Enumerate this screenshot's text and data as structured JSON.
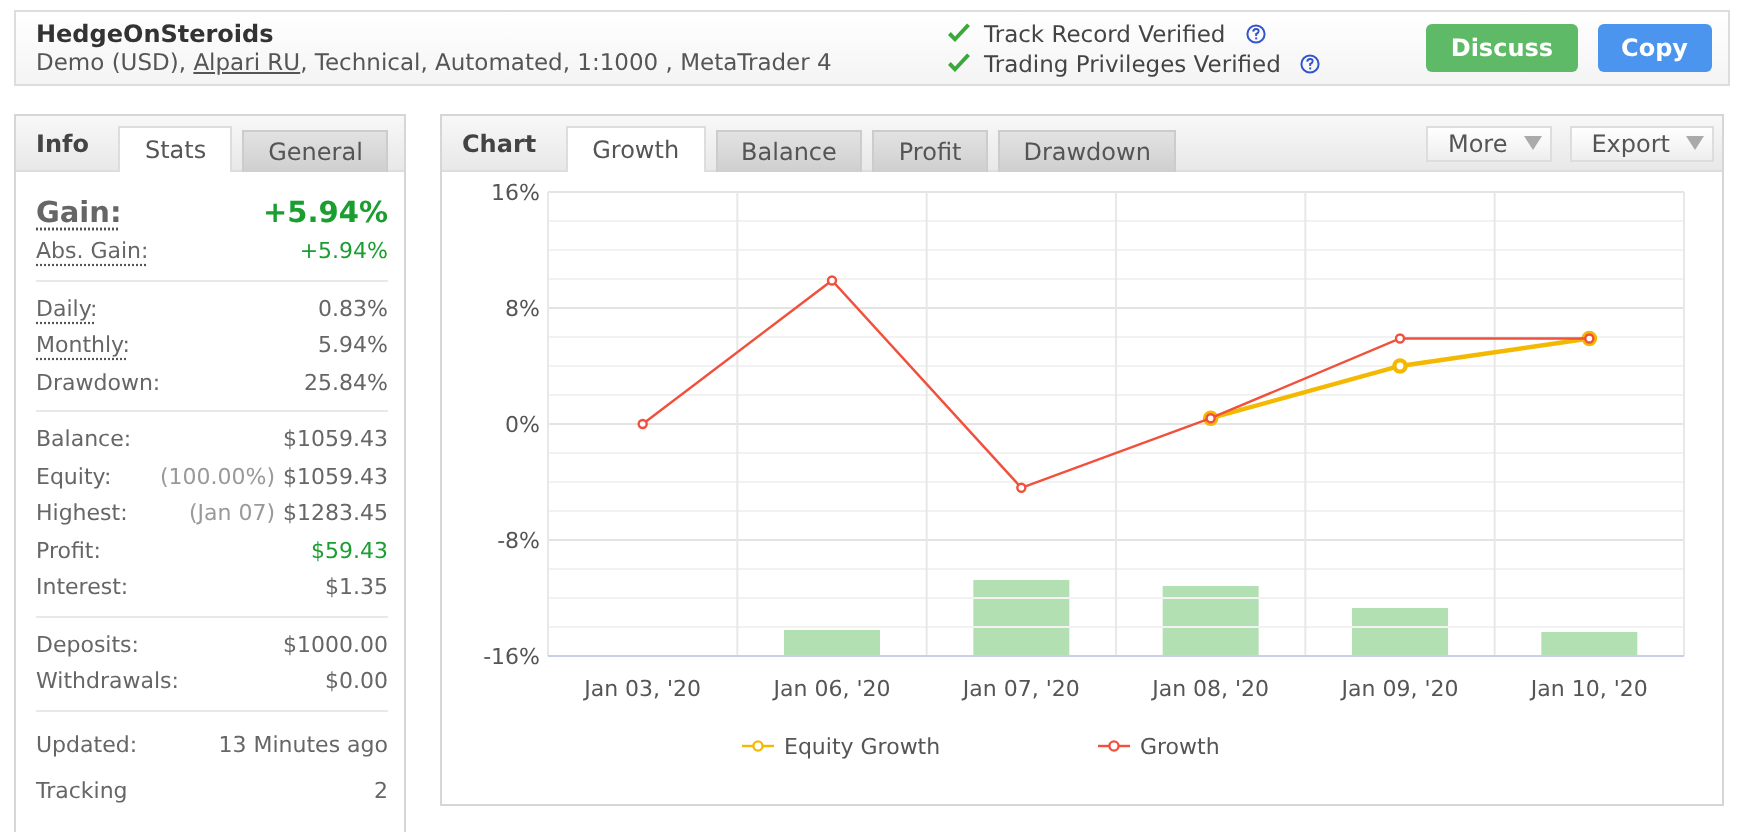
{
  "header": {
    "title": "HedgeOnSteroids",
    "subtitle": [
      {
        "kind": "text",
        "text": "Demo (USD), "
      },
      {
        "kind": "link",
        "text": "Alpari RU"
      },
      {
        "kind": "text",
        "text": ", Technical, Automated, 1:1000 , MetaTrader 4"
      }
    ],
    "verifications": [
      {
        "label": "Track Record Verified",
        "verified": true
      },
      {
        "label": "Trading Privileges Verified",
        "verified": true
      }
    ],
    "buttons": [
      {
        "label": "Discuss",
        "kind": "discuss"
      },
      {
        "label": "Copy",
        "kind": "copy"
      }
    ]
  },
  "info": {
    "title": "Info",
    "tabs": [
      {
        "label": "Stats",
        "selected": true
      },
      {
        "label": "General",
        "selected": false
      }
    ],
    "groups": [
      [
        {
          "label": "Gain:",
          "value": "+5.94%",
          "kind": "headline",
          "positive": true,
          "hint": true
        },
        {
          "label": "Abs. Gain:",
          "value": "+5.94%",
          "positive": true,
          "hint": true
        }
      ],
      [
        {
          "label": "Daily:",
          "value": "0.83%",
          "positive": false,
          "hint": true
        },
        {
          "label": "Monthly:",
          "value": "5.94%",
          "positive": false,
          "hint": true
        },
        {
          "label": "Drawdown:",
          "value": "25.84%",
          "positive": false,
          "hint": false
        }
      ],
      [
        {
          "label": "Balance:",
          "value": "$1059.43",
          "positive": false,
          "hint": false
        },
        {
          "label": "Equity:",
          "note": "(100.00%)",
          "value": "$1059.43",
          "positive": false,
          "hint": false
        },
        {
          "label": "Highest:",
          "note": "(Jan 07)",
          "value": "$1283.45",
          "positive": false,
          "hint": false
        },
        {
          "label": "Profit:",
          "value": "$59.43",
          "positive": true,
          "hint": false
        },
        {
          "label": "Interest:",
          "value": "$1.35",
          "positive": false,
          "hint": false
        }
      ],
      [
        {
          "label": "Deposits:",
          "value": "$1000.00",
          "positive": false,
          "hint": false
        },
        {
          "label": "Withdrawals:",
          "value": "$0.00",
          "positive": false,
          "hint": false
        }
      ],
      [
        {
          "label": "Updated:",
          "value": "13 Minutes ago",
          "positive": false,
          "hint": false
        },
        {
          "label": "Tracking",
          "value": "2",
          "positive": false,
          "hint": false
        }
      ]
    ]
  },
  "chart": {
    "title": "Chart",
    "tabs": [
      {
        "label": "Growth",
        "selected": true
      },
      {
        "label": "Balance",
        "selected": false
      },
      {
        "label": "Profit",
        "selected": false
      },
      {
        "label": "Drawdown",
        "selected": false
      }
    ],
    "menus": [
      {
        "label": "More"
      },
      {
        "label": "Export"
      }
    ],
    "chart_data": {
      "type": "line",
      "categories": [
        "Jan 03, '20",
        "Jan 06, '20",
        "Jan 07, '20",
        "Jan 08, '20",
        "Jan 09, '20",
        "Jan 10, '20"
      ],
      "ylim": [
        -16,
        16
      ],
      "grid": true,
      "legend": true,
      "yticks": [
        {
          "value": -16,
          "label": "-16%"
        },
        {
          "value": -8,
          "label": "-8%"
        },
        {
          "value": 0,
          "label": "0%"
        },
        {
          "value": 8,
          "label": "8%"
        },
        {
          "value": 16,
          "label": "16%"
        }
      ],
      "series": [
        {
          "name": "Equity Growth",
          "color": "#f5b800",
          "marker": "circle",
          "values": [
            null,
            null,
            null,
            0.4,
            4.0,
            5.9
          ]
        },
        {
          "name": "Growth",
          "color": "#f0503c",
          "marker": "circle",
          "values": [
            0,
            9.9,
            -4.4,
            0.4,
            5.9,
            5.9
          ]
        }
      ]
    }
  }
}
